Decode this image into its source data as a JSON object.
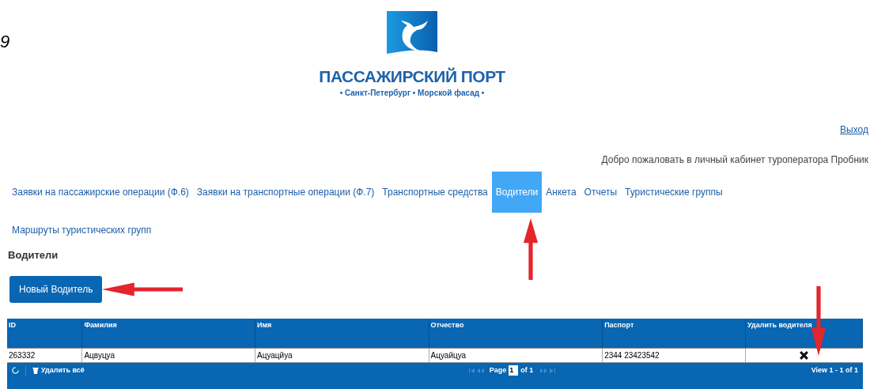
{
  "corner_text": "9",
  "logo": {
    "title": "ПАССАЖИРСКИЙ ПОРТ",
    "subtitle": "• Санкт-Петербург • Морской фасад •"
  },
  "logout": "Выход",
  "welcome": "Добро пожаловать в личный кабинет туроператора Пробник",
  "nav": [
    {
      "label": "Заявки на пассажирские операции (Ф.6)",
      "selected": false
    },
    {
      "label": "Заявки на транспортные операции (Ф.7)",
      "selected": false
    },
    {
      "label": "Транспортные средства",
      "selected": false
    },
    {
      "label": "Водители",
      "selected": true
    },
    {
      "label": "Анкета",
      "selected": false
    },
    {
      "label": "Отчеты",
      "selected": false
    },
    {
      "label": "Туристические группы",
      "selected": false
    },
    {
      "label": "Маршруты туристических групп",
      "selected": false
    }
  ],
  "heading": "Водители",
  "new_button": "Новый Водитель",
  "table": {
    "columns": [
      "ID",
      "Фамилия",
      "Имя",
      "Отчество",
      "Паспорт",
      "Удалить водителя"
    ],
    "rows": [
      [
        "263332",
        "Ацвуцуа",
        "Ацуацйуа",
        "Ацуайцуа",
        "2344 23423542"
      ]
    ]
  },
  "footer": {
    "delete_all": "Удалить всё",
    "page_label": "Page",
    "page_value": "1",
    "page_of": "of 1",
    "view": "View 1 - 1 of 1"
  }
}
